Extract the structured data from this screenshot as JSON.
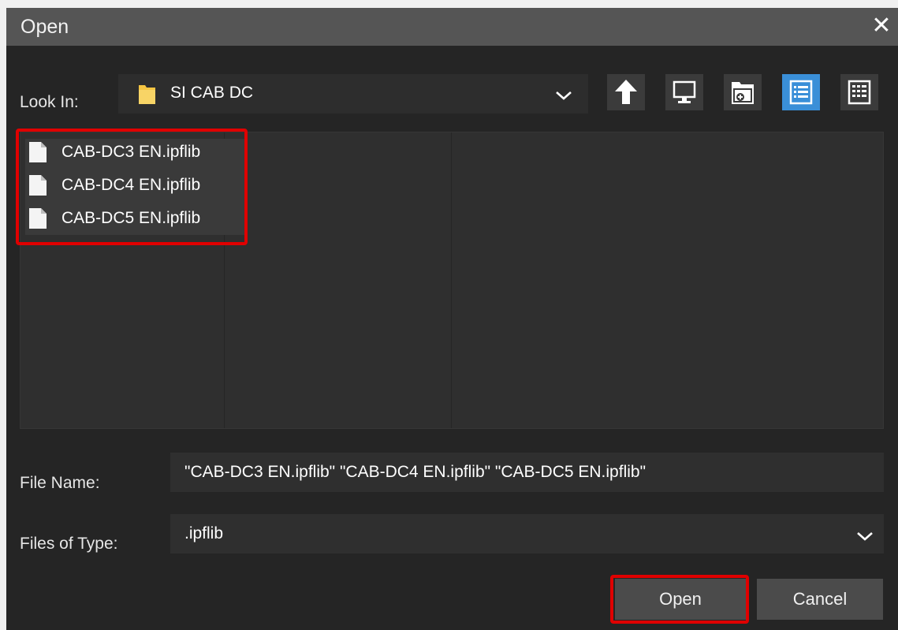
{
  "dialog": {
    "title": "Open",
    "close_glyph": "✕"
  },
  "look_in": {
    "label": "Look In:",
    "value": "SI CAB DC",
    "icon": "folder-icon"
  },
  "toolbar": [
    {
      "name": "up-one-level-button",
      "icon": "arrow-up-icon"
    },
    {
      "name": "desktop-button",
      "icon": "monitor-icon"
    },
    {
      "name": "new-folder-button",
      "icon": "new-folder-icon"
    },
    {
      "name": "list-view-button",
      "icon": "list-view-icon",
      "active": true
    },
    {
      "name": "details-view-button",
      "icon": "details-view-icon"
    }
  ],
  "files": [
    {
      "name": "CAB-DC3 EN.ipflib"
    },
    {
      "name": "CAB-DC4 EN.ipflib"
    },
    {
      "name": "CAB-DC5 EN.ipflib"
    }
  ],
  "file_name": {
    "label": "File Name:",
    "value": "\"CAB-DC3 EN.ipflib\" \"CAB-DC4 EN.ipflib\" \"CAB-DC5 EN.ipflib\""
  },
  "file_type": {
    "label": "Files of Type:",
    "value": ".ipflib"
  },
  "buttons": {
    "open": "Open",
    "cancel": "Cancel"
  },
  "colors": {
    "accent": "#3a8fd8",
    "highlight": "#e00000",
    "background": "#252525"
  }
}
